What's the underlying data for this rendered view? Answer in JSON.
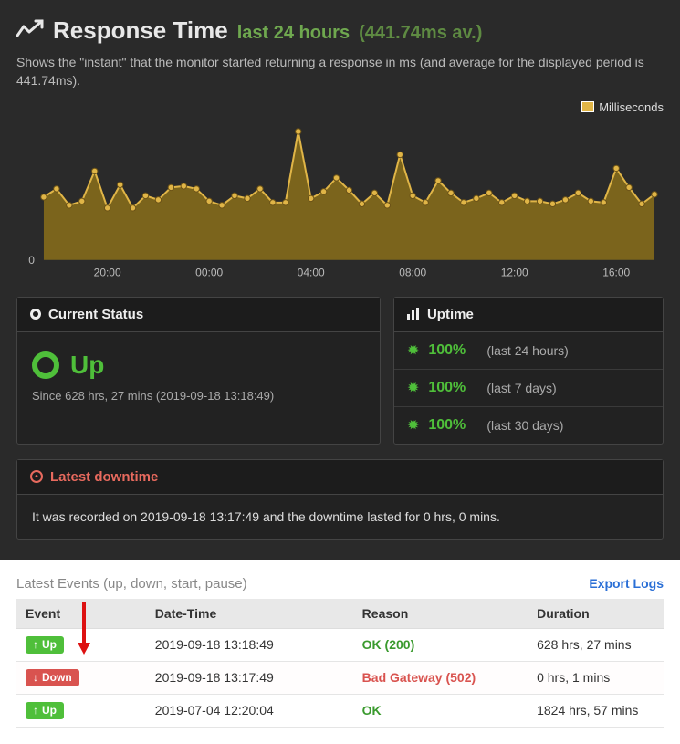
{
  "header": {
    "title": "Response Time",
    "subtitle": "last 24 hours",
    "avg": "(441.74ms av.)",
    "description": "Shows the \"instant\" that the monitor started returning a response in ms (and average for the displayed period is 441.74ms).",
    "legend_label": "Milliseconds"
  },
  "colors": {
    "yellow": "#e0b547",
    "yellow_fill": "#8a6f1a",
    "green": "#4fbf3a",
    "red": "#e86a5e"
  },
  "chart_data": {
    "type": "line",
    "title": "Response Time",
    "xlabel": "",
    "ylabel": "ms",
    "ylim": [
      0,
      1000
    ],
    "x_ticks": [
      "20:00",
      "00:00",
      "04:00",
      "08:00",
      "12:00",
      "16:00"
    ],
    "y_ticks": [
      0
    ],
    "series": [
      {
        "name": "Milliseconds",
        "x": [
          "17:30",
          "18:00",
          "18:30",
          "19:00",
          "19:30",
          "20:00",
          "20:30",
          "21:00",
          "21:30",
          "22:00",
          "22:30",
          "23:00",
          "23:30",
          "00:00",
          "00:30",
          "01:00",
          "01:30",
          "02:00",
          "02:30",
          "03:00",
          "03:30",
          "04:00",
          "04:30",
          "05:00",
          "05:30",
          "06:00",
          "06:30",
          "07:00",
          "07:30",
          "08:00",
          "08:30",
          "09:00",
          "09:30",
          "10:00",
          "10:30",
          "11:00",
          "11:30",
          "12:00",
          "12:30",
          "13:00",
          "13:30",
          "14:00",
          "14:30",
          "15:00",
          "15:30",
          "16:00",
          "16:30",
          "17:00",
          "17:30"
        ],
        "values": [
          460,
          520,
          400,
          430,
          650,
          380,
          550,
          380,
          470,
          440,
          530,
          540,
          520,
          430,
          400,
          470,
          450,
          520,
          420,
          420,
          940,
          450,
          500,
          600,
          510,
          410,
          490,
          400,
          770,
          470,
          420,
          580,
          490,
          420,
          450,
          490,
          420,
          470,
          430,
          430,
          410,
          440,
          490,
          430,
          420,
          670,
          530,
          410,
          480
        ]
      }
    ]
  },
  "current_status": {
    "header": "Current Status",
    "state": "Up",
    "since": "Since 628 hrs, 27 mins (2019-09-18 13:18:49)"
  },
  "uptime": {
    "header": "Uptime",
    "rows": [
      {
        "pct": "100%",
        "label": "(last 24 hours)"
      },
      {
        "pct": "100%",
        "label": "(last 7 days)"
      },
      {
        "pct": "100%",
        "label": "(last 30 days)"
      }
    ]
  },
  "downtime": {
    "header": "Latest downtime",
    "body": "It was recorded on 2019-09-18 13:17:49 and the downtime lasted for 0 hrs, 0 mins."
  },
  "latest_events": {
    "title": "Latest Events",
    "subtitle": "(up, down, start, pause)",
    "export": "Export Logs",
    "columns": [
      "Event",
      "Date-Time",
      "Reason",
      "Duration"
    ],
    "rows": [
      {
        "event": "Up",
        "event_type": "up",
        "datetime": "2019-09-18 13:18:49",
        "reason": "OK (200)",
        "reason_type": "ok",
        "duration": "628 hrs, 27 mins",
        "highlight": false
      },
      {
        "event": "Down",
        "event_type": "down",
        "datetime": "2019-09-18 13:17:49",
        "reason": "Bad Gateway (502)",
        "reason_type": "bad",
        "duration": "0 hrs, 1 mins",
        "highlight": true
      },
      {
        "event": "Up",
        "event_type": "up",
        "datetime": "2019-07-04 12:20:04",
        "reason": "OK",
        "reason_type": "ok",
        "duration": "1824 hrs, 57 mins",
        "highlight": false
      }
    ]
  }
}
